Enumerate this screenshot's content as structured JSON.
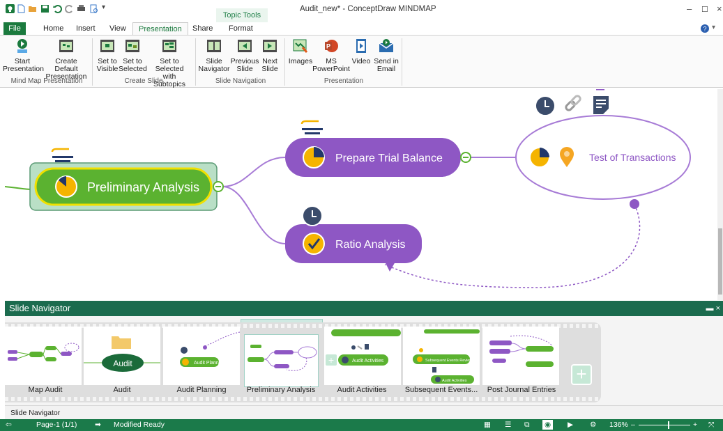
{
  "window": {
    "title": "Audit_new* - ConceptDraw MINDMAP",
    "contextual_tab": "Topic Tools"
  },
  "tabs": [
    "File",
    "Home",
    "Insert",
    "View",
    "Presentation",
    "Share",
    "Format"
  ],
  "ribbon": {
    "groups": [
      {
        "label": "Mind Map Presentation",
        "buttons": [
          {
            "line1": "Start",
            "line2": "Presentation"
          },
          {
            "line1": "Create Default",
            "line2": "Presentation"
          }
        ]
      },
      {
        "label": "Create Slide",
        "buttons": [
          {
            "line1": "Set to",
            "line2": "Visible"
          },
          {
            "line1": "Set to",
            "line2": "Selected"
          },
          {
            "line1": "Set to Selected",
            "line2": "with Subtopics"
          }
        ]
      },
      {
        "label": "Slide Navigation",
        "buttons": [
          {
            "line1": "Slide",
            "line2": "Navigator"
          },
          {
            "line1": "Previous",
            "line2": "Slide"
          },
          {
            "line1": "Next",
            "line2": "Slide"
          }
        ]
      },
      {
        "label": "Presentation",
        "buttons": [
          {
            "line1": "Images",
            "line2": ""
          },
          {
            "line1": "MS",
            "line2": "PowerPoint"
          },
          {
            "line1": "Video",
            "line2": ""
          },
          {
            "line1": "Send in",
            "line2": "Email"
          }
        ]
      }
    ]
  },
  "map": {
    "central": "Preliminary Analysis",
    "trial_balance": "Prepare Trial Balance",
    "ratio": "Ratio Analysis",
    "transactions": "Test of Transactions"
  },
  "slide_navigator": {
    "title": "Slide Navigator",
    "slides": [
      "Map Audit",
      "Audit",
      "Audit Planning",
      "Preliminary Analysis",
      "Audit Activities",
      "Subsequent Events...",
      "Post Journal Entries"
    ],
    "thumb_text": {
      "audit": "Audit",
      "audit_planning": "Audit Planning",
      "audit_activities": "Audit Activities",
      "subsequent": "Subsequent Events Review",
      "audit_activities_small": "Audit Activities"
    },
    "tab_label": "Slide Navigator"
  },
  "status": {
    "page": "Page-1 (1/1)",
    "state": "Modified  Ready",
    "zoom": "136%"
  },
  "colors": {
    "green": "#1b7a3e",
    "purple": "#8e57c4",
    "central_green": "#5bb230",
    "orange": "#f5b400"
  }
}
